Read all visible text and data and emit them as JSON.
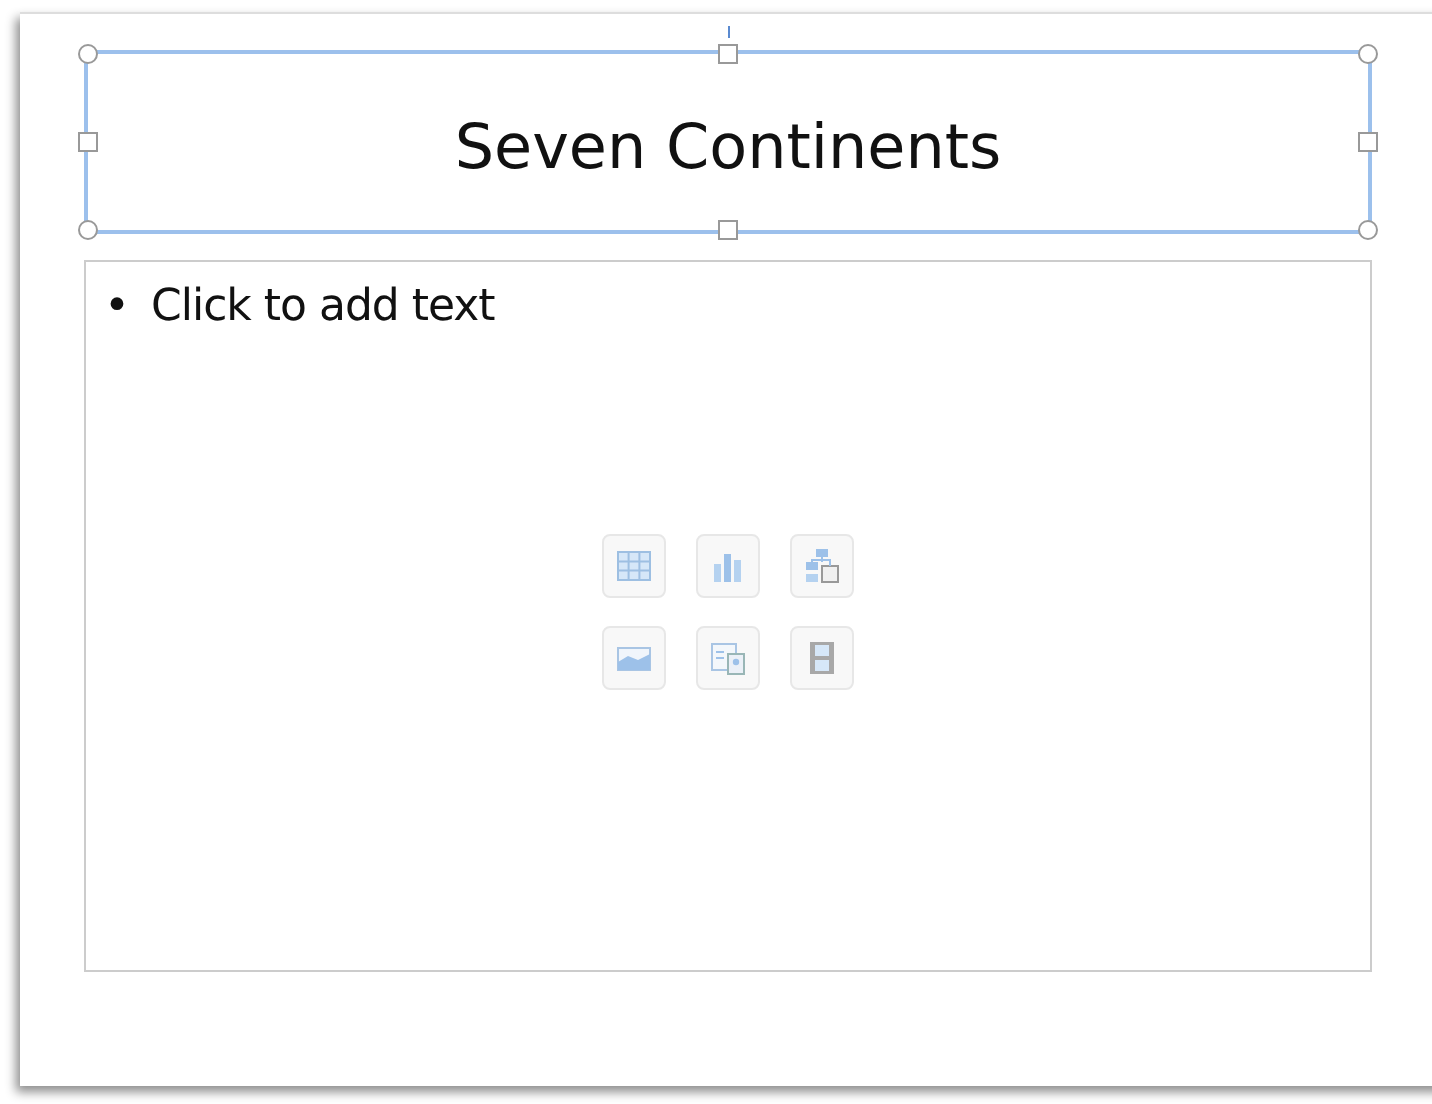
{
  "slide": {
    "title": {
      "text": "Seven Continents",
      "selected": true
    },
    "content": {
      "bullet": "•",
      "placeholder": "Click to add text",
      "insert_buttons": [
        {
          "kind": "table"
        },
        {
          "kind": "chart"
        },
        {
          "kind": "smartart"
        },
        {
          "kind": "picture"
        },
        {
          "kind": "clipart"
        },
        {
          "kind": "movie"
        }
      ]
    }
  }
}
